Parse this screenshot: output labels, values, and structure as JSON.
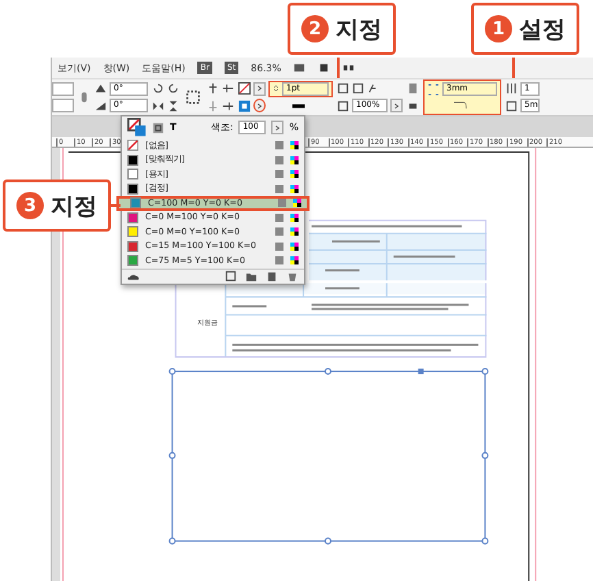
{
  "callouts": [
    {
      "number": "2",
      "label": "지정"
    },
    {
      "number": "1",
      "label": "설정"
    },
    {
      "number": "3",
      "label": "지정"
    }
  ],
  "menu_bar": {
    "items": [
      "보기(V)",
      "창(W)",
      "도움말(H)"
    ],
    "badges": [
      "Br",
      "St"
    ],
    "zoom": "86.3%"
  },
  "control_panel": {
    "angle_1": "0°",
    "angle_2": "0°",
    "stroke_weight": "1pt",
    "scale": "100%",
    "corner_size": "3mm",
    "columns": "1",
    "gutter": "5m"
  },
  "swatches_panel": {
    "type_label": "T",
    "tint_label": "색조:",
    "tint": "100",
    "percent": "%",
    "swatches": [
      {
        "name": "[없음]",
        "kind": "none",
        "color": "#ffffff",
        "selected": false
      },
      {
        "name": "[맞춰찍기]",
        "kind": "color",
        "color": "#000000",
        "selected": false
      },
      {
        "name": "[용지]",
        "kind": "color",
        "color": "#ffffff",
        "selected": false
      },
      {
        "name": "[검정]",
        "kind": "color",
        "color": "#000000",
        "selected": false
      },
      {
        "name": "C=100 M=0 Y=0 K=0",
        "kind": "color",
        "color": "#1e8fb0",
        "selected": true
      },
      {
        "name": "C=0 M=100 Y=0 K=0",
        "kind": "color",
        "color": "#e0157f",
        "selected": false
      },
      {
        "name": "C=0 M=0 Y=100 K=0",
        "kind": "color",
        "color": "#ffee00",
        "selected": false
      },
      {
        "name": "C=15 M=100 Y=100 K=0",
        "kind": "color",
        "color": "#d7262f",
        "selected": false
      },
      {
        "name": "C=75 M=5 Y=100 K=0",
        "kind": "color",
        "color": "#2aa843",
        "selected": false
      }
    ]
  },
  "ruler": {
    "left_labels": [
      "0",
      "10",
      "20",
      "30"
    ],
    "right_labels": [
      "90",
      "100",
      "110",
      "120",
      "130",
      "140",
      "150",
      "160",
      "170",
      "180",
      "190",
      "200",
      "210"
    ]
  },
  "document": {
    "form_label": "지원금"
  }
}
